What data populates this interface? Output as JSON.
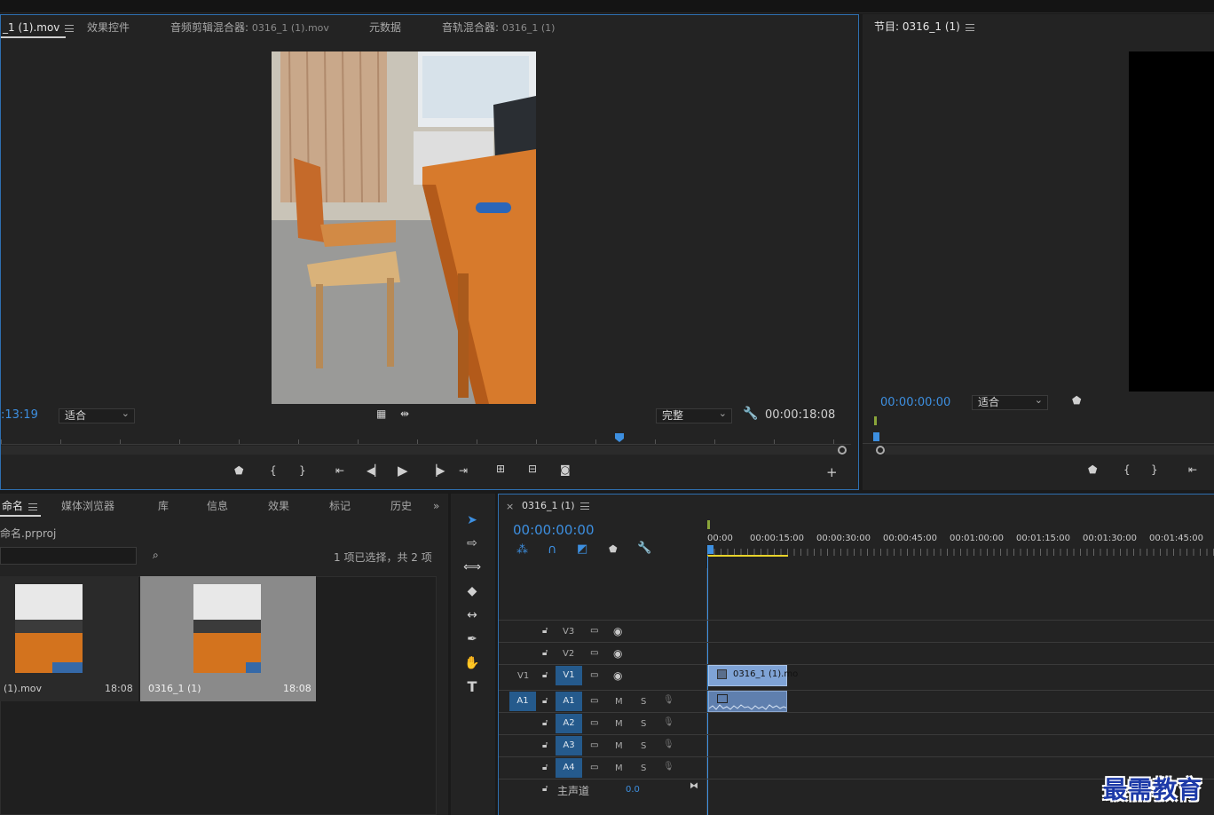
{
  "source_monitor": {
    "tabs": [
      {
        "label": "_1 (1).mov",
        "active": true
      },
      {
        "label": "效果控件"
      },
      {
        "label": "音频剪辑混合器:",
        "sub": "0316_1 (1).mov"
      },
      {
        "label": "元数据"
      },
      {
        "label": "音轨混合器:",
        "sub": "0316_1 (1)"
      }
    ],
    "timecode_left": ":13:19",
    "fit_select": "适合",
    "quality_select": "完整",
    "duration": "00:00:18:08"
  },
  "program_monitor": {
    "tab_label": "节目: 0316_1 (1)",
    "timecode": "00:00:00:00",
    "fit_select": "适合"
  },
  "project_panel": {
    "tabs": [
      "命名",
      "媒体浏览器",
      "库",
      "信息",
      "效果",
      "标记",
      "历史"
    ],
    "project_file": "命名.prproj",
    "selection_info": "1 项已选择，共 2 项",
    "items": [
      {
        "name": "(1).mov",
        "duration": "18:08",
        "selected": false
      },
      {
        "name": "0316_1 (1)",
        "duration": "18:08",
        "selected": true
      }
    ]
  },
  "timeline": {
    "tab_label": "0316_1 (1)",
    "timecode": "00:00:00:00",
    "ruler": [
      "00:00",
      "00:00:15:00",
      "00:00:30:00",
      "00:00:45:00",
      "00:01:00:00",
      "00:01:15:00",
      "00:01:30:00",
      "00:01:45:00"
    ],
    "video_tracks": [
      "V3",
      "V2",
      "V1"
    ],
    "source_v": "V1",
    "audio_tracks": [
      "A1",
      "A2",
      "A3",
      "A4"
    ],
    "source_a": "A1",
    "mute_label": "M",
    "solo_label": "S",
    "master_label": "主声道",
    "master_value": "0.0",
    "clip_label": "0316_1 (1).mo"
  },
  "watermark": "最需教育",
  "colors": {
    "accent": "#3d8fe0",
    "panel_border": "#2e6fb0",
    "track_target": "#255a8c",
    "clip_video": "#7fa3d6",
    "clip_audio": "#5f7fae",
    "work_area": "#e8d32a"
  }
}
